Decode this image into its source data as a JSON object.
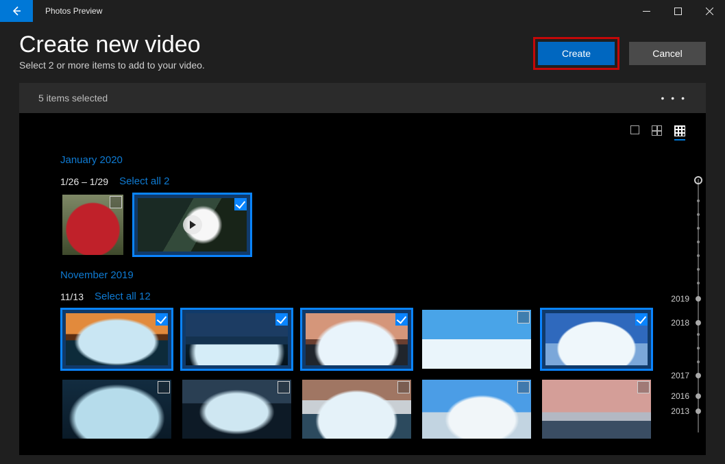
{
  "titlebar": {
    "app_title": "Photos Preview"
  },
  "header": {
    "title": "Create new video",
    "subtitle": "Select 2 or more items to add to your video.",
    "create_label": "Create",
    "cancel_label": "Cancel"
  },
  "selection_bar": {
    "status": "5 items selected"
  },
  "view_modes": {
    "active": "small-grid"
  },
  "groups": [
    {
      "heading": "January 2020",
      "date_range": "1/26 – 1/29",
      "select_all_label": "Select all 2",
      "items": [
        {
          "id": "photo-apple",
          "selected": false,
          "is_video": false
        },
        {
          "id": "video-stream",
          "selected": true,
          "is_video": true
        }
      ]
    },
    {
      "heading": "November 2019",
      "date_range": "11/13",
      "select_all_label": "Select all 12",
      "items": [
        {
          "id": "ice-1",
          "selected": true,
          "is_video": false
        },
        {
          "id": "ice-2",
          "selected": true,
          "is_video": false
        },
        {
          "id": "ice-3",
          "selected": true,
          "is_video": false
        },
        {
          "id": "ice-4",
          "selected": false,
          "is_video": false
        },
        {
          "id": "ice-5",
          "selected": true,
          "is_video": false
        },
        {
          "id": "ice-6",
          "selected": false,
          "is_video": false
        },
        {
          "id": "ice-7",
          "selected": false,
          "is_video": false
        },
        {
          "id": "ice-8",
          "selected": false,
          "is_video": false
        },
        {
          "id": "ice-9",
          "selected": false,
          "is_video": false
        },
        {
          "id": "ice-10",
          "selected": false,
          "is_video": false
        }
      ]
    }
  ],
  "timeline": {
    "years": [
      "2019",
      "2018",
      "2017",
      "2016",
      "2013"
    ]
  }
}
